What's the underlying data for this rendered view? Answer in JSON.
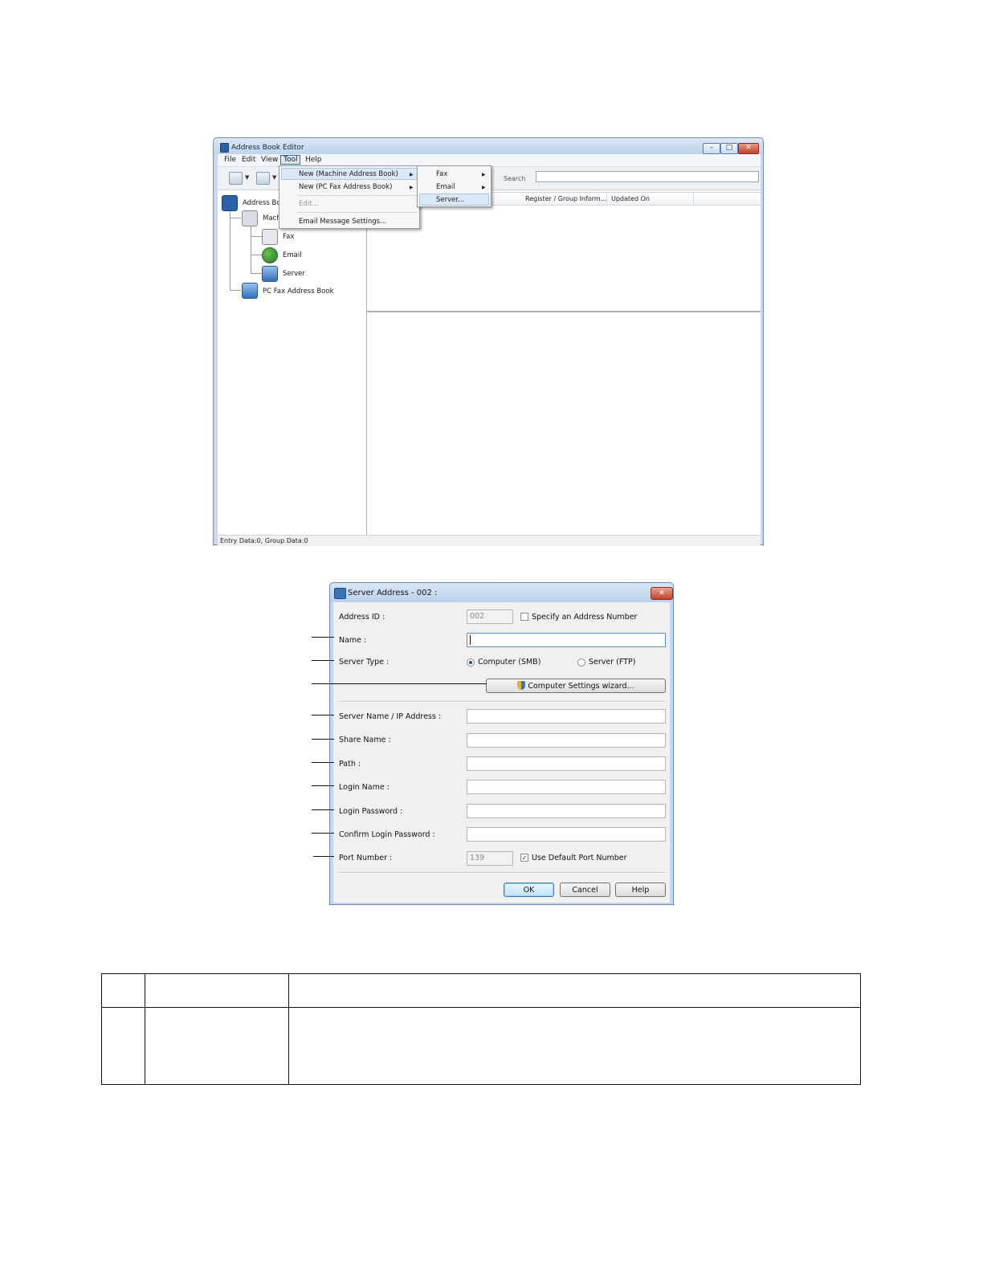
{
  "address_book_editor": {
    "title": "Address Book Editor",
    "window_buttons": {
      "minimize": "–",
      "maximize": "□",
      "close": "✕"
    },
    "menu": [
      "File",
      "Edit",
      "View",
      "Tool",
      "Help"
    ],
    "toolbar": {
      "search_label": "Search",
      "search_value": ""
    },
    "tree": {
      "root": "Address Boo",
      "machine": "Mach",
      "fax": "Fax",
      "email": "Email",
      "server": "Server",
      "pc_fax": "PC Fax Address Book"
    },
    "list_columns": [
      "Register / Group Inform...",
      "Updated On"
    ],
    "tool_menu": {
      "new_machine": "New (Machine Address Book)",
      "new_pc_fax": "New (PC Fax Address Book)",
      "edit": "Edit...",
      "email_settings": "Email Message Settings..."
    },
    "submenu": {
      "fax": "Fax",
      "email": "Email",
      "server": "Server..."
    },
    "status": "Entry Data:0, Group Data:0"
  },
  "server_dialog": {
    "title": "Server Address - 002 :",
    "close": "✕",
    "address_id_label": "Address ID :",
    "address_id_value": "002",
    "specify_label": "Specify an Address Number",
    "name_label": "Name :",
    "name_value": "",
    "server_type_label": "Server Type :",
    "computer_smb": "Computer (SMB)",
    "server_ftp": "Server (FTP)",
    "wizard_button": "Computer Settings wizard...",
    "server_name_label": "Server Name / IP Address :",
    "share_name_label": "Share Name :",
    "path_label": "Path :",
    "login_name_label": "Login Name :",
    "login_password_label": "Login Password :",
    "confirm_password_label": "Confirm Login Password :",
    "port_label": "Port Number :",
    "port_value": "139",
    "default_port_label": "Use Default Port Number",
    "default_port_check": "✓",
    "ok": "OK",
    "cancel": "Cancel",
    "help": "Help"
  },
  "colors": {
    "window_frame": "#c9daee",
    "title_blue": "#2d61a7",
    "close_red": "#c4412a",
    "menu_highlight": "#dbe8f8"
  }
}
